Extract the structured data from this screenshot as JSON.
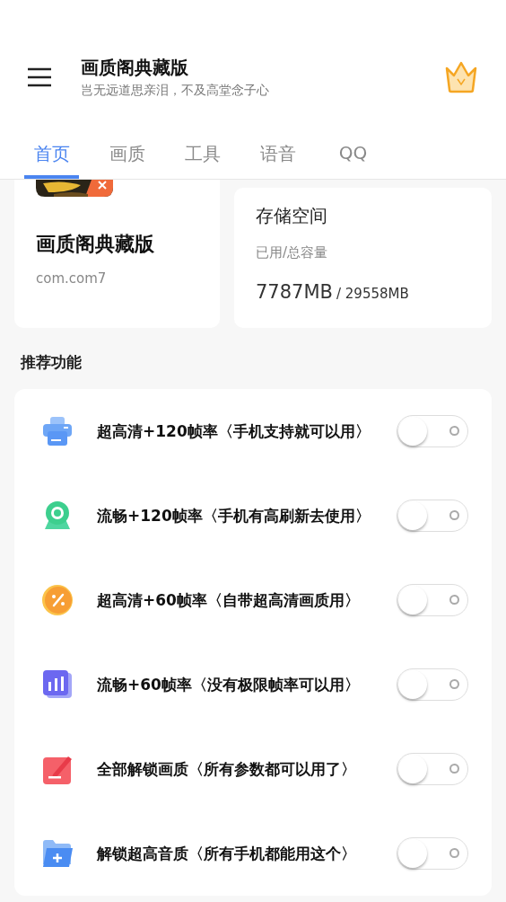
{
  "app_bar": {
    "title": "画质阁典藏版",
    "subtitle": "岂无远道思亲泪，不及高堂念子心"
  },
  "tabs": [
    {
      "label": "首页",
      "selected": true
    },
    {
      "label": "画质",
      "selected": false
    },
    {
      "label": "工具",
      "selected": false
    },
    {
      "label": "语音",
      "selected": false
    },
    {
      "label": "QQ",
      "selected": false
    }
  ],
  "app_card": {
    "name": "画质阁典藏版",
    "package": "com.com7"
  },
  "storage_card": {
    "title": "存储空间",
    "caption": "已用/总容量",
    "used": "7787MB",
    "total": "/ 29558MB"
  },
  "section_title": "推荐功能",
  "features": [
    {
      "kind": "printer",
      "label": "超高清+120帧率〈手机支持就可以用〉",
      "on": false
    },
    {
      "kind": "webcam",
      "label": "流畅+120帧率〈手机有高刷新去使用〉",
      "on": false
    },
    {
      "kind": "percent",
      "label": "超高清+60帧率〈自带超高清画质用〉",
      "on": false
    },
    {
      "kind": "chart",
      "label": "流畅+60帧率〈没有极限帧率可以用〉",
      "on": false
    },
    {
      "kind": "edit",
      "label": "全部解锁画质〈所有参数都可以用了〉",
      "on": false
    },
    {
      "kind": "folder",
      "label": "解锁超高音质〈所有手机都能用这个〉",
      "on": false
    }
  ]
}
